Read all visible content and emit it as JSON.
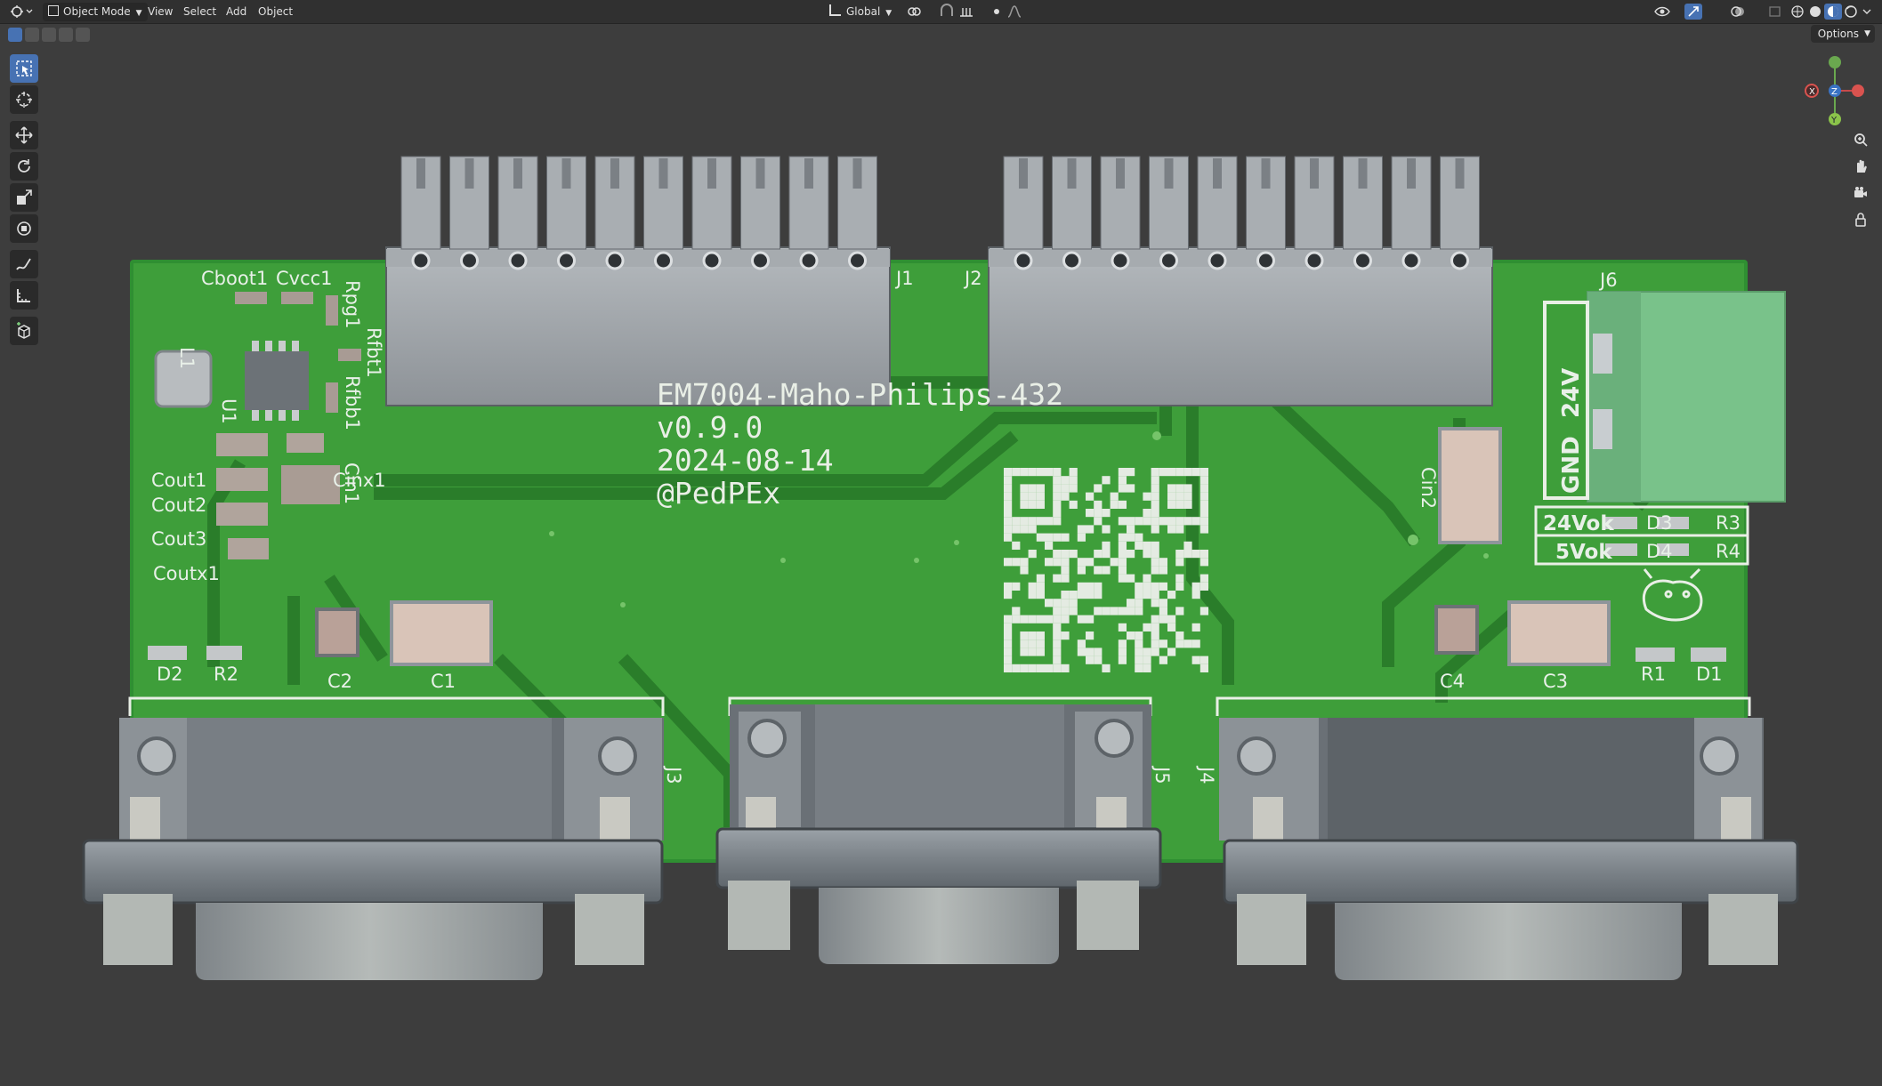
{
  "header": {
    "mode": "Object Mode",
    "menus": [
      "View",
      "Select",
      "Add",
      "Object"
    ],
    "transform_orientation": "Global",
    "options": "Options"
  },
  "gizmo": {
    "x": "X",
    "y": "Y",
    "z": "Z"
  },
  "board": {
    "title": "EM7004-Maho-Philips-432",
    "version": "v0.9.0",
    "date": "2024-08-14",
    "author": "@PedPEx",
    "j6_pin_top": "24V",
    "j6_pin_bottom": "GND",
    "led_24": "24Vok",
    "led_5": "5Vok",
    "ref": {
      "J1": "J1",
      "J2": "J2",
      "J3": "J3",
      "J4": "J4",
      "J5": "J5",
      "J6": "J6",
      "L1": "L1",
      "U1": "U1",
      "Cboot1": "Cboot1",
      "Cvcc1": "Cvcc1",
      "Rpg1": "Rpg1",
      "Rfbt1": "Rfbt1",
      "Rfbb1": "Rfbb1",
      "Cout1": "Cout1",
      "Cout2": "Cout2",
      "Cout3": "Cout3",
      "Coutx1": "Coutx1",
      "Cinx1": "Cinx1",
      "Cin1": "Cin1",
      "Cin2": "Cin2",
      "D1": "D1",
      "D2": "D2",
      "D3": "D3",
      "D4": "D4",
      "R1": "R1",
      "R2": "R2",
      "R3": "R3",
      "R4": "R4",
      "C1": "C1",
      "C2": "C2",
      "C3": "C3",
      "C4": "C4"
    }
  },
  "colors": {
    "viewport": "#3d3d3d",
    "pcb": "#3a9a3a",
    "copper": "#2f8a2f",
    "silkscreen": "#e9efe6",
    "metal": "#8e959b",
    "header_plastic": "#9ea3a8",
    "terminal_green": "#7cc48c",
    "accent": "#4772b3"
  }
}
